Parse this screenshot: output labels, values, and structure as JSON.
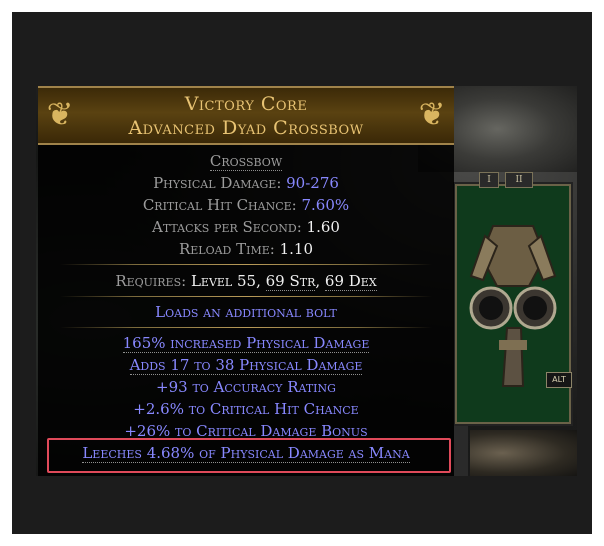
{
  "item": {
    "name": "Victory Core",
    "base": "Advanced Dyad Crossbow",
    "item_class": "Crossbow",
    "properties": [
      {
        "label": "Physical Damage: ",
        "value": "90-276",
        "value_style": "blue"
      },
      {
        "label": "Critical Hit Chance: ",
        "value": "7.60%",
        "value_style": "blue"
      },
      {
        "label": "Attacks per Second: ",
        "value": "1.60",
        "value_style": "white"
      },
      {
        "label": "Reload Time: ",
        "value": "1.10",
        "value_style": "white"
      }
    ],
    "requirements": {
      "label": "Requires: ",
      "level": "Level 55",
      "str": "69 Str",
      "dex": "69 Dex"
    },
    "implicit": "Loads an additional bolt",
    "explicit_mods": [
      "165% increased Physical Damage",
      "Adds 17 to 38 Physical Damage",
      "+93 to Accuracy Rating",
      "+2.6% to Critical Hit Chance",
      "+26% to Critical Damage Bonus",
      "Leeches 4.68% of Physical Damage as Mana"
    ]
  },
  "equipment_panel": {
    "alt_label": "ALT",
    "tab1": "I",
    "tab2": "II"
  },
  "colors": {
    "unique_name": "#e8c373",
    "magic_blue": "#8888ff",
    "highlight_border": "#e04a5a",
    "panel_green": "#0f3a1c"
  },
  "icons": [
    "ornate-corner-icon",
    "crossbow-icon"
  ]
}
